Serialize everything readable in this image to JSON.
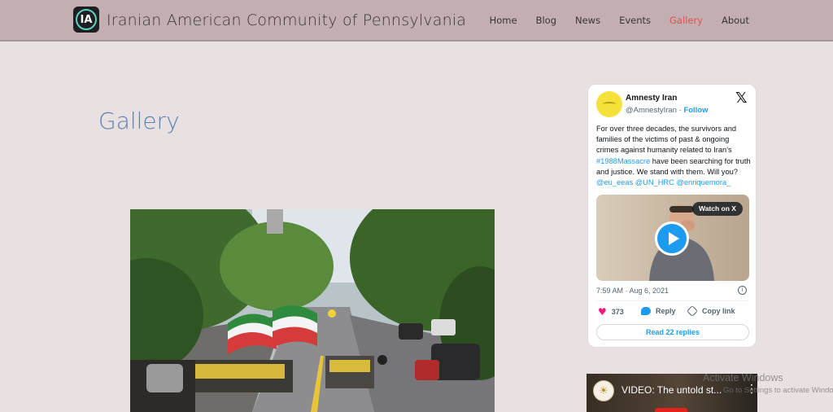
{
  "site": {
    "logo_text": "IA",
    "title": "Iranian American Community of Pennsylvania"
  },
  "nav": {
    "items": [
      {
        "label": "Home"
      },
      {
        "label": "Blog"
      },
      {
        "label": "News"
      },
      {
        "label": "Events"
      },
      {
        "label": "Gallery",
        "active": true
      },
      {
        "label": "About"
      }
    ]
  },
  "main": {
    "title": "Gallery",
    "photo_icon": "street-rally-photo"
  },
  "tweet": {
    "author_name": "Amnesty Iran",
    "handle": "@AmnestyIran",
    "separator": " · ",
    "follow_label": "Follow",
    "text_1": "For over three decades, the survivors and families of the victims of past & ongoing crimes against humanity related to Iran's ",
    "hashtag": "#1988Massacre",
    "text_2": " have been searching for truth and justice. We stand with them. Will you? ",
    "mentions": "@eu_eeas @UN_HRC @enriquemora_",
    "watch_label": "Watch on X",
    "timestamp": "7:59 AM · Aug 6, 2021",
    "likes": "373",
    "reply_label": "Reply",
    "copy_link_label": "Copy link",
    "read_replies_label": "Read 22 replies",
    "colors": {
      "accent": "#1d9bf0",
      "like": "#f91880"
    }
  },
  "youtube": {
    "title": "VIDEO: The untold st...",
    "menu_icon": "vertical-dots-icon"
  },
  "watermark": {
    "line1": "Activate Windows",
    "line2": "Go to Settings to activate Windows"
  },
  "colors": {
    "header_bg": "#c3afb2",
    "page_bg": "#e9e0e1",
    "title_blue": "#5a82b5",
    "nav_active": "#d9534f"
  }
}
